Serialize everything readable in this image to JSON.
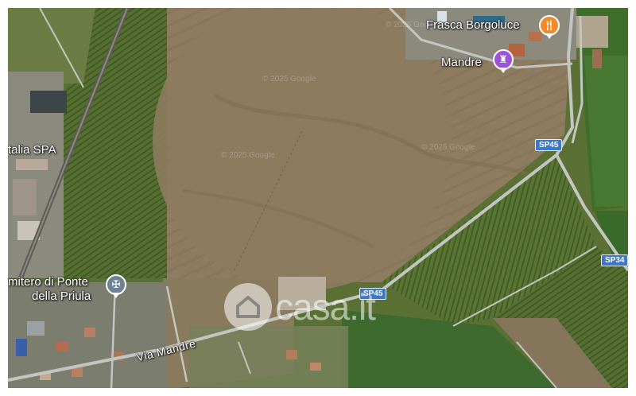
{
  "map": {
    "pois": {
      "restaurant": "Frasca Borgoluce",
      "landmark": "Mandre",
      "cemetery_line1": "mitero di Ponte",
      "cemetery_line2": "della Priula",
      "company": "talia SPA"
    },
    "roads": {
      "via_mandre": "Via Mandre",
      "sp45_a": "SP45",
      "sp45_b": "SP45",
      "sp34": "SP34"
    },
    "watermark": "© 2025 Google",
    "icons": {
      "restaurant": "fork-knife-icon",
      "landmark": "castle-icon",
      "cemetery": "cemetery-icon",
      "brand": "house-icon"
    },
    "colors": {
      "field_brown": "#8c7a5e",
      "vineyard_green": "#4f6a2c",
      "road": "#b9bcb8",
      "shield_blue": "#3d78c7",
      "poi_orange": "#f08a2c",
      "poi_purple": "#9b53d8"
    }
  },
  "brand": {
    "logo_text": "casa.it"
  }
}
